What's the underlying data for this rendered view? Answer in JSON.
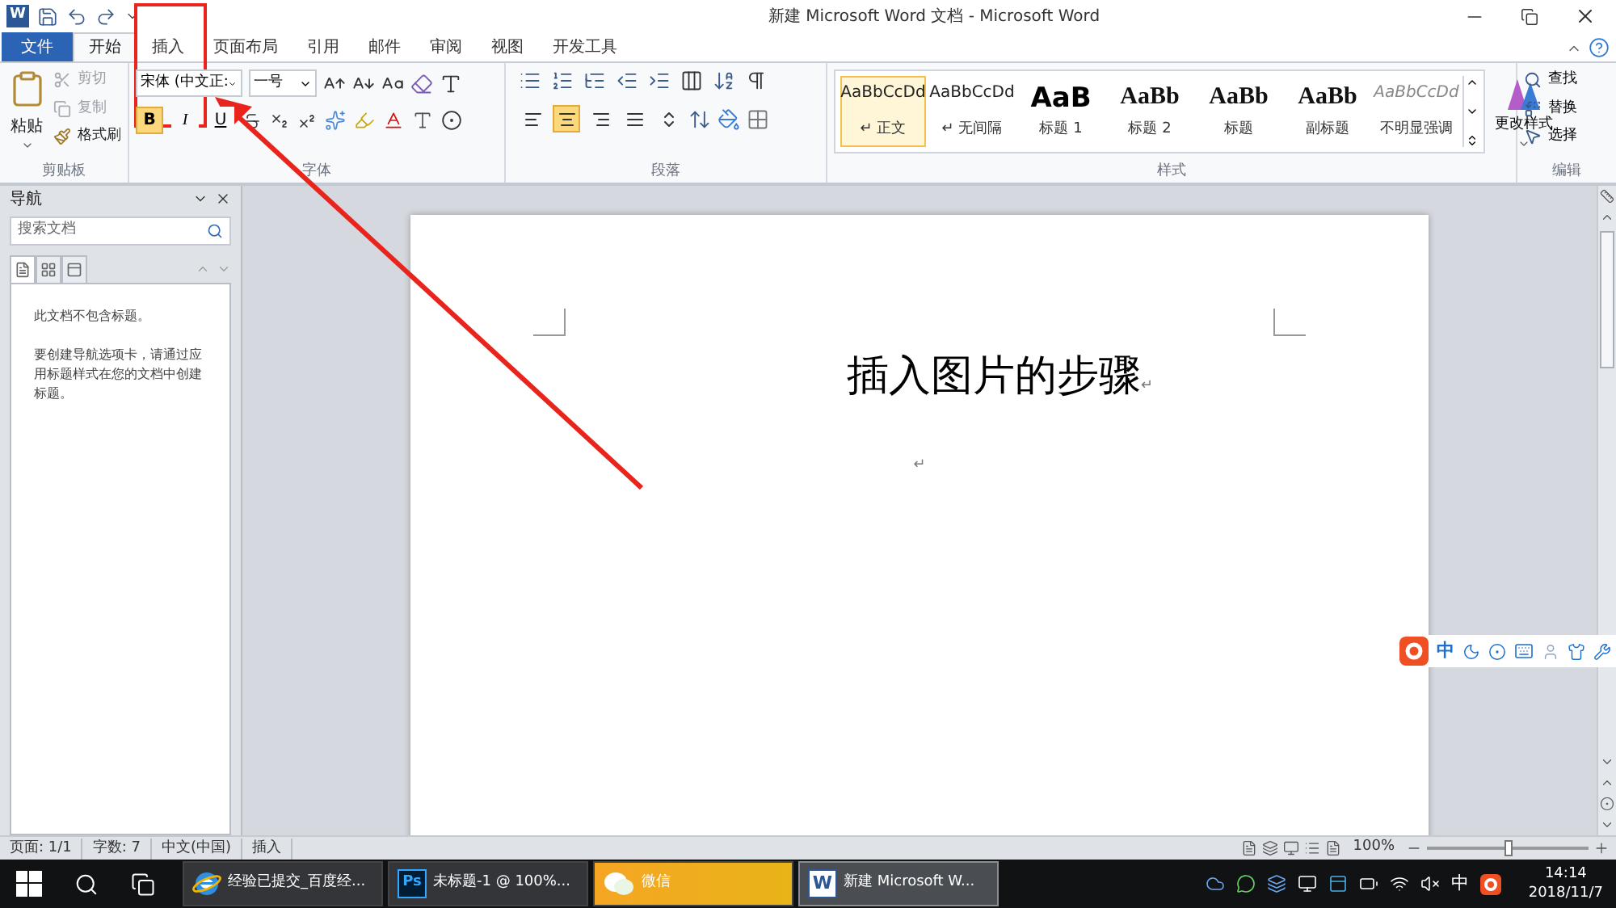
{
  "window": {
    "title": "新建 Microsoft Word 文档 - Microsoft Word",
    "app_letter": "W"
  },
  "tabs": [
    {
      "label": "文件",
      "kind": "file",
      "selected": false
    },
    {
      "label": "开始",
      "kind": "tab",
      "selected": true
    },
    {
      "label": "插入",
      "kind": "tab",
      "selected": false
    },
    {
      "label": "页面布局",
      "kind": "tab",
      "selected": false
    },
    {
      "label": "引用",
      "kind": "tab",
      "selected": false
    },
    {
      "label": "邮件",
      "kind": "tab",
      "selected": false
    },
    {
      "label": "审阅",
      "kind": "tab",
      "selected": false
    },
    {
      "label": "视图",
      "kind": "tab",
      "selected": false
    },
    {
      "label": "开发工具",
      "kind": "tab",
      "selected": false
    }
  ],
  "clipboard": {
    "group": "剪贴板",
    "paste": "粘贴",
    "items": [
      {
        "label": "剪切",
        "disabled": true
      },
      {
        "label": "复制",
        "disabled": true
      },
      {
        "label": "格式刷",
        "disabled": false
      }
    ]
  },
  "font": {
    "group": "字体",
    "font_name": "宋体 (中文正:",
    "font_size": "一号",
    "format_buttons": [
      {
        "label": "B",
        "selected": true
      },
      {
        "label": "I",
        "selected": false
      },
      {
        "label": "U",
        "selected": false
      }
    ]
  },
  "paragraph": {
    "group": "段落",
    "alignment_buttons": [
      {
        "selected": false
      },
      {
        "selected": true
      },
      {
        "selected": false
      },
      {
        "selected": false
      },
      {
        "selected": false
      }
    ]
  },
  "styles": {
    "group": "样式",
    "change": "更改样式",
    "items": [
      {
        "preview": "AaBbCcDd",
        "name": "↵ 正文",
        "kind": "normal",
        "selected": true
      },
      {
        "preview": "AaBbCcDd",
        "name": "↵ 无间隔",
        "kind": "normal",
        "selected": false
      },
      {
        "preview": "AaB",
        "name": "标题 1",
        "kind": "heading1",
        "selected": false
      },
      {
        "preview": "AaBb",
        "name": "标题 2",
        "kind": "heading",
        "selected": false
      },
      {
        "preview": "AaBb",
        "name": "标题",
        "kind": "heading",
        "selected": false
      },
      {
        "preview": "AaBb",
        "name": "副标题",
        "kind": "heading",
        "selected": false
      },
      {
        "preview": "AaBbCcDd",
        "name": "不明显强调",
        "kind": "emphasis",
        "selected": false
      }
    ]
  },
  "editing": {
    "group": "编辑",
    "items": [
      {
        "label": "查找",
        "kind": "find"
      },
      {
        "label": "替换",
        "kind": "replace"
      },
      {
        "label": "选择",
        "kind": "select"
      }
    ]
  },
  "navigation": {
    "title": "导航",
    "search": {
      "placeholder": "搜索文档"
    },
    "tabs": [
      {
        "kind": "headings",
        "selected": true
      },
      {
        "kind": "pages",
        "selected": false
      },
      {
        "kind": "results",
        "selected": false
      }
    ],
    "message": "此文档不包含标题。",
    "hint": "要创建导航选项卡，请通过应用标题样式在您的文档中创建标题。"
  },
  "document": {
    "paragraphs": [
      {
        "kind": "heading",
        "text": "插入图片的步骤",
        "mark": "↵"
      },
      {
        "kind": "empty",
        "mark": "↵"
      }
    ]
  },
  "ime_toolbar": {
    "mode": "中"
  },
  "status_bar": {
    "items": [
      "页面: 1/1",
      "字数: 7",
      "中文(中国)",
      "插入"
    ],
    "zoom": "100%",
    "zoom_slider": {
      "level": 0.5
    }
  },
  "taskbar": {
    "apps": [
      {
        "kind": "ie",
        "label": "经验已提交_百度经...",
        "selected": false,
        "flashing": false
      },
      {
        "kind": "ps",
        "icon_text": "Ps",
        "label": "未标题-1 @ 100%...",
        "selected": false,
        "flashing": false
      },
      {
        "kind": "wechat",
        "label": "微信",
        "selected": false,
        "flashing": true
      },
      {
        "kind": "word",
        "icon_text": "W",
        "label": "新建 Microsoft W...",
        "selected": true,
        "flashing": false
      }
    ],
    "input_mode": "中",
    "time": "14:14",
    "date": "2018/11/7"
  }
}
